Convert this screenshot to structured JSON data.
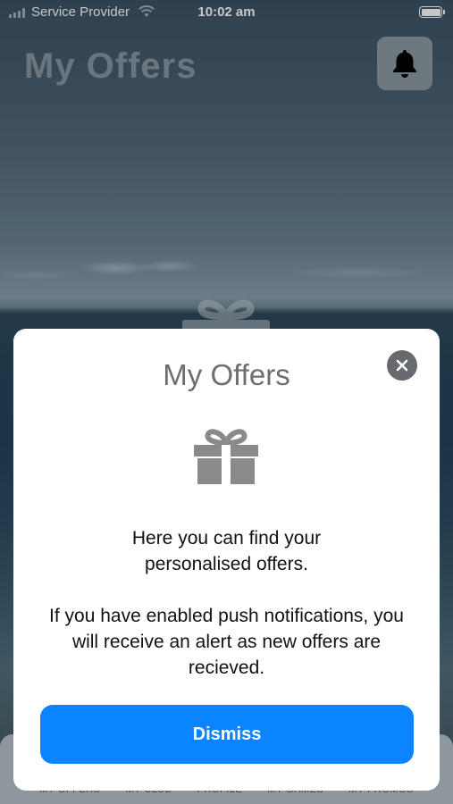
{
  "status_bar": {
    "carrier": "Service Provider",
    "time": "10:02 am",
    "wifi_icon": "wifi-icon",
    "battery_icon": "battery-icon"
  },
  "header": {
    "title": "My Offers",
    "bell_icon": "bell-icon"
  },
  "tab_bar": {
    "items": [
      "MY OFFERS",
      "MY CLUB",
      "PROFILE",
      "MY GAMES",
      "MY PROMOS"
    ]
  },
  "modal": {
    "title": "My Offers",
    "icon": "gift-icon",
    "close_icon": "close-icon",
    "paragraph_1": "Here you can find your personalised offers.",
    "paragraph_2": "If you have enabled push notifications, you will receive an alert as new offers are recieved.",
    "dismiss_label": "Dismiss"
  },
  "colors": {
    "accent": "#0a84ff",
    "modal_background": "#ffffff",
    "close_button": "#666a6e"
  }
}
